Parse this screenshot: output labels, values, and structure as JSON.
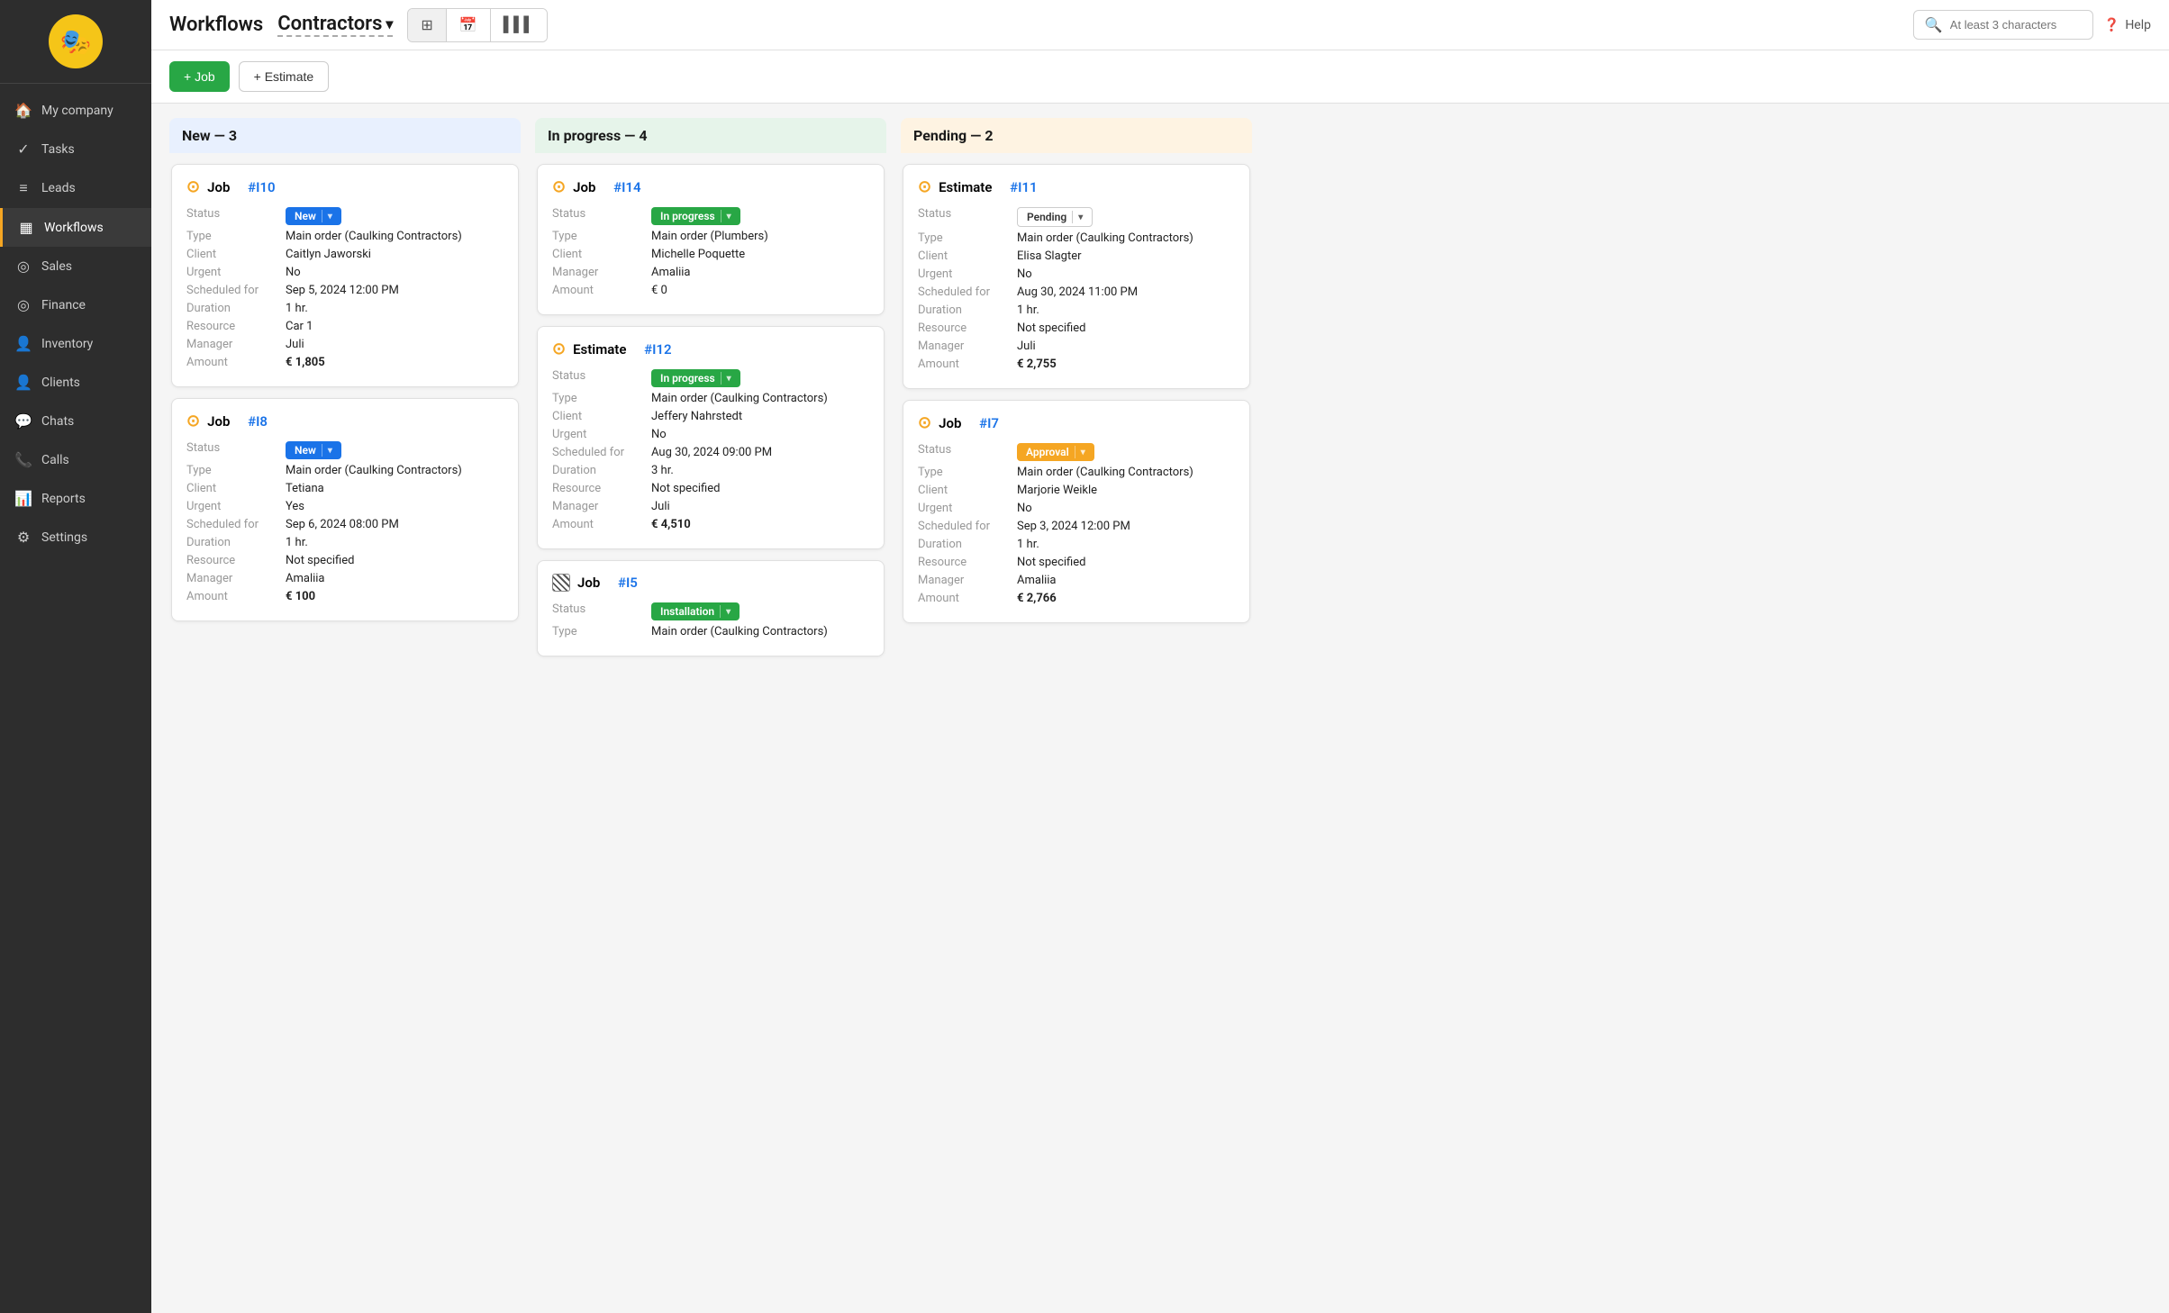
{
  "sidebar": {
    "logo_emoji": "🎭",
    "items": [
      {
        "id": "my-company",
        "label": "My company",
        "icon": "🏠"
      },
      {
        "id": "tasks",
        "label": "Tasks",
        "icon": "✓"
      },
      {
        "id": "leads",
        "label": "Leads",
        "icon": "≡"
      },
      {
        "id": "workflows",
        "label": "Workflows",
        "icon": "▦",
        "active": true
      },
      {
        "id": "sales",
        "label": "Sales",
        "icon": "◎"
      },
      {
        "id": "finance",
        "label": "Finance",
        "icon": "◎"
      },
      {
        "id": "inventory",
        "label": "Inventory",
        "icon": "👤"
      },
      {
        "id": "clients",
        "label": "Clients",
        "icon": "👤"
      },
      {
        "id": "chats",
        "label": "Chats",
        "icon": "💬"
      },
      {
        "id": "calls",
        "label": "Calls",
        "icon": "📞"
      },
      {
        "id": "reports",
        "label": "Reports",
        "icon": "📊"
      },
      {
        "id": "settings",
        "label": "Settings",
        "icon": "⚙"
      }
    ]
  },
  "header": {
    "title": "Workflows",
    "subtitle": "Contractors",
    "chevron": "▾",
    "search_placeholder": "At least 3 characters",
    "help_label": "Help",
    "views": [
      {
        "id": "grid",
        "icon": "⊞",
        "active": true
      },
      {
        "id": "calendar",
        "icon": "▦"
      },
      {
        "id": "chart",
        "icon": "▌▌▌"
      }
    ]
  },
  "toolbar": {
    "add_job_label": "+ Job",
    "add_estimate_label": "+ Estimate"
  },
  "columns": [
    {
      "id": "new",
      "header": "New — 3",
      "type": "new",
      "cards": [
        {
          "id": "card-i10",
          "icon_type": "circle",
          "title_prefix": "Job",
          "title_id": "#I10",
          "status_label": "New",
          "status_type": "new",
          "rows": [
            {
              "label": "Status",
              "value": "New",
              "value_type": "badge_new"
            },
            {
              "label": "Type",
              "value": "Main order (Caulking Contractors)"
            },
            {
              "label": "Client",
              "value": "Caitlyn Jaworski"
            },
            {
              "label": "Urgent",
              "value": "No"
            },
            {
              "label": "Scheduled for",
              "value": "Sep 5, 2024 12:00 PM"
            },
            {
              "label": "Duration",
              "value": "1 hr."
            },
            {
              "label": "Resource",
              "value": "Car 1"
            },
            {
              "label": "Manager",
              "value": "Juli"
            },
            {
              "label": "Amount",
              "value": "€ 1,805",
              "bold": true
            }
          ]
        },
        {
          "id": "card-i8",
          "icon_type": "circle",
          "title_prefix": "Job",
          "title_id": "#I8",
          "status_label": "New",
          "status_type": "new",
          "rows": [
            {
              "label": "Status",
              "value": "New",
              "value_type": "badge_new"
            },
            {
              "label": "Type",
              "value": "Main order (Caulking Contractors)"
            },
            {
              "label": "Client",
              "value": "Tetiana"
            },
            {
              "label": "Urgent",
              "value": "Yes"
            },
            {
              "label": "Scheduled for",
              "value": "Sep 6, 2024 08:00 PM"
            },
            {
              "label": "Duration",
              "value": "1 hr."
            },
            {
              "label": "Resource",
              "value": "Not specified"
            },
            {
              "label": "Manager",
              "value": "Amaliia"
            },
            {
              "label": "Amount",
              "value": "€ 100",
              "bold": true
            }
          ]
        }
      ]
    },
    {
      "id": "in-progress",
      "header": "In progress — 4",
      "type": "progress",
      "cards": [
        {
          "id": "card-i14",
          "icon_type": "circle",
          "title_prefix": "Job",
          "title_id": "#I14",
          "rows": [
            {
              "label": "Status",
              "value": "In progress",
              "value_type": "badge_inprogress"
            },
            {
              "label": "Type",
              "value": "Main order (Plumbers)"
            },
            {
              "label": "Client",
              "value": "Michelle Poquette"
            },
            {
              "label": "Manager",
              "value": "Amaliia"
            },
            {
              "label": "Amount",
              "value": "€ 0"
            }
          ]
        },
        {
          "id": "card-i12",
          "icon_type": "circle",
          "title_prefix": "Estimate",
          "title_id": "#I12",
          "rows": [
            {
              "label": "Status",
              "value": "In progress",
              "value_type": "badge_inprogress"
            },
            {
              "label": "Type",
              "value": "Main order (Caulking Contractors)"
            },
            {
              "label": "Client",
              "value": "Jeffery Nahrstedt"
            },
            {
              "label": "Urgent",
              "value": "No"
            },
            {
              "label": "Scheduled for",
              "value": "Aug 30, 2024 09:00 PM"
            },
            {
              "label": "Duration",
              "value": "3 hr."
            },
            {
              "label": "Resource",
              "value": "Not specified"
            },
            {
              "label": "Manager",
              "value": "Juli"
            },
            {
              "label": "Amount",
              "value": "€ 4,510",
              "bold": true
            }
          ]
        },
        {
          "id": "card-i5",
          "icon_type": "striped",
          "title_prefix": "Job",
          "title_id": "#I5",
          "rows": [
            {
              "label": "Status",
              "value": "Installation",
              "value_type": "badge_installation"
            },
            {
              "label": "Type",
              "value": "Main order (Caulking Contractors)"
            }
          ]
        }
      ]
    },
    {
      "id": "pending",
      "header": "Pending — 2",
      "type": "pending",
      "cards": [
        {
          "id": "card-i11",
          "icon_type": "circle",
          "title_prefix": "Estimate",
          "title_id": "#I11",
          "rows": [
            {
              "label": "Status",
              "value": "Pending",
              "value_type": "badge_pending"
            },
            {
              "label": "Type",
              "value": "Main order (Caulking Contractors)"
            },
            {
              "label": "Client",
              "value": "Elisa Slagter"
            },
            {
              "label": "Urgent",
              "value": "No"
            },
            {
              "label": "Scheduled for",
              "value": "Aug 30, 2024 11:00 PM"
            },
            {
              "label": "Duration",
              "value": "1 hr."
            },
            {
              "label": "Resource",
              "value": "Not specified"
            },
            {
              "label": "Manager",
              "value": "Juli"
            },
            {
              "label": "Amount",
              "value": "€ 2,755",
              "bold": true
            }
          ]
        },
        {
          "id": "card-i7",
          "icon_type": "circle",
          "title_prefix": "Job",
          "title_id": "#I7",
          "rows": [
            {
              "label": "Status",
              "value": "Approval",
              "value_type": "badge_approval"
            },
            {
              "label": "Type",
              "value": "Main order (Caulking Contractors)"
            },
            {
              "label": "Client",
              "value": "Marjorie Weikle"
            },
            {
              "label": "Urgent",
              "value": "No"
            },
            {
              "label": "Scheduled for",
              "value": "Sep 3, 2024 12:00 PM"
            },
            {
              "label": "Duration",
              "value": "1 hr."
            },
            {
              "label": "Resource",
              "value": "Not specified"
            },
            {
              "label": "Manager",
              "value": "Amaliia"
            },
            {
              "label": "Amount",
              "value": "€ 2,766",
              "bold": true
            }
          ]
        }
      ]
    }
  ]
}
